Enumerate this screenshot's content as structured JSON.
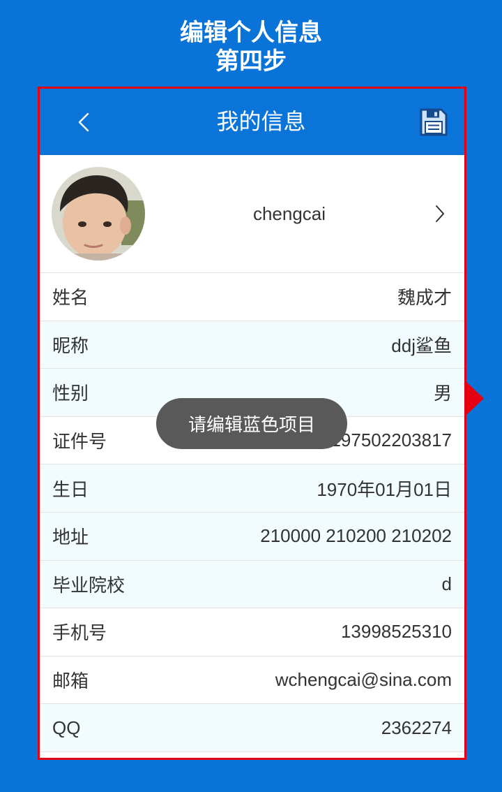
{
  "page": {
    "title_line1": "编辑个人信息",
    "title_line2": "第四步"
  },
  "header": {
    "title": "我的信息",
    "back_icon": "chevron-left-icon",
    "save_icon": "floppy-disk-icon"
  },
  "profile": {
    "username": "chengcai",
    "chevron_icon": "chevron-right-icon"
  },
  "fields": [
    {
      "label": "姓名",
      "value": "魏成才",
      "highlighted": false
    },
    {
      "label": "昵称",
      "value": "ddj鲨鱼",
      "highlighted": true
    },
    {
      "label": "性别",
      "value": "男",
      "highlighted": true
    },
    {
      "label": "证件号",
      "value": "211226197502203817",
      "highlighted": false
    },
    {
      "label": "生日",
      "value": "1970年01月01日",
      "highlighted": true
    },
    {
      "label": "地址",
      "value": "210000 210200 210202",
      "highlighted": true
    },
    {
      "label": "毕业院校",
      "value": "d",
      "highlighted": true
    },
    {
      "label": "手机号",
      "value": "13998525310",
      "highlighted": false
    },
    {
      "label": "邮箱",
      "value": "wchengcai@sina.com",
      "highlighted": false
    },
    {
      "label": "QQ",
      "value": "2362274",
      "highlighted": true
    }
  ],
  "toast": {
    "text": "请编辑蓝色项目"
  },
  "colors": {
    "page_bg": "#0a73d8",
    "header_bg": "#0b74d9",
    "frame_border": "#e60012",
    "highlight_row_bg": "#f2fbfd",
    "toast_bg": "#595959",
    "pointer": "#e60012"
  }
}
